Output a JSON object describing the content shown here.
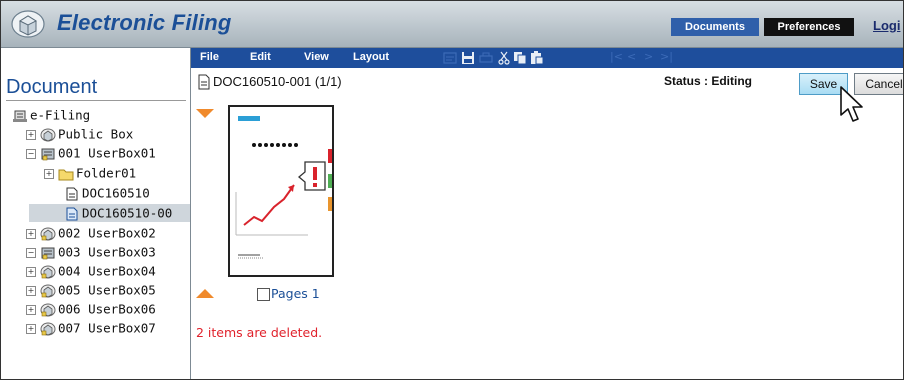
{
  "app": {
    "title": "Electronic Filing"
  },
  "header": {
    "tabs": [
      {
        "label": "Documents",
        "active": true
      },
      {
        "label": "Preferences",
        "active": false
      }
    ],
    "login_label": "Logi"
  },
  "menu": {
    "items": [
      "File",
      "Edit",
      "View",
      "Layout"
    ],
    "toolbar_icons": [
      "import-icon",
      "save-icon",
      "print-icon",
      "cut-icon",
      "copy-icon",
      "paste-icon"
    ],
    "nav_glyphs": [
      "|<",
      "<",
      ">",
      ">|"
    ]
  },
  "left_panel": {
    "title": "Document",
    "tree": [
      {
        "label": "e-Filing",
        "icon": "efiling-icon",
        "level": 0
      },
      {
        "label": "Public Box",
        "icon": "box-icon",
        "level": 1,
        "expander": "+"
      },
      {
        "label": "001 UserBox01",
        "icon": "userbox-open-icon",
        "level": 1,
        "expander": "−"
      },
      {
        "label": "Folder01",
        "icon": "folder-icon",
        "level": 2,
        "expander": "+"
      },
      {
        "label": "DOC160510",
        "icon": "document-icon",
        "level": 2
      },
      {
        "label": "DOC160510-00",
        "icon": "document-selected-icon",
        "level": 2,
        "selected": true
      },
      {
        "label": "002 UserBox02",
        "icon": "userbox-icon",
        "level": 1,
        "expander": "+"
      },
      {
        "label": "003 UserBox03",
        "icon": "userbox-open-icon",
        "level": 1,
        "expander": "−"
      },
      {
        "label": "004 UserBox04",
        "icon": "userbox-icon",
        "level": 1,
        "expander": "+"
      },
      {
        "label": "005 UserBox05",
        "icon": "userbox-icon",
        "level": 1,
        "expander": "+"
      },
      {
        "label": "006 UserBox06",
        "icon": "userbox-icon",
        "level": 1,
        "expander": "+"
      },
      {
        "label": "007 UserBox07",
        "icon": "userbox-icon",
        "level": 1,
        "expander": "+"
      }
    ]
  },
  "document": {
    "title": "DOC160510-001 (1/1)",
    "status": "Status : Editing",
    "buttons": {
      "save": "Save",
      "cancel": "Cancel"
    },
    "page_label": "Pages 1",
    "page_checked": false,
    "message": "2 items are deleted."
  },
  "colors": {
    "brand_blue": "#1b4f97",
    "menubar": "#1e4e9c",
    "arrow_orange": "#f08a2c",
    "error_red": "#e0222c"
  }
}
